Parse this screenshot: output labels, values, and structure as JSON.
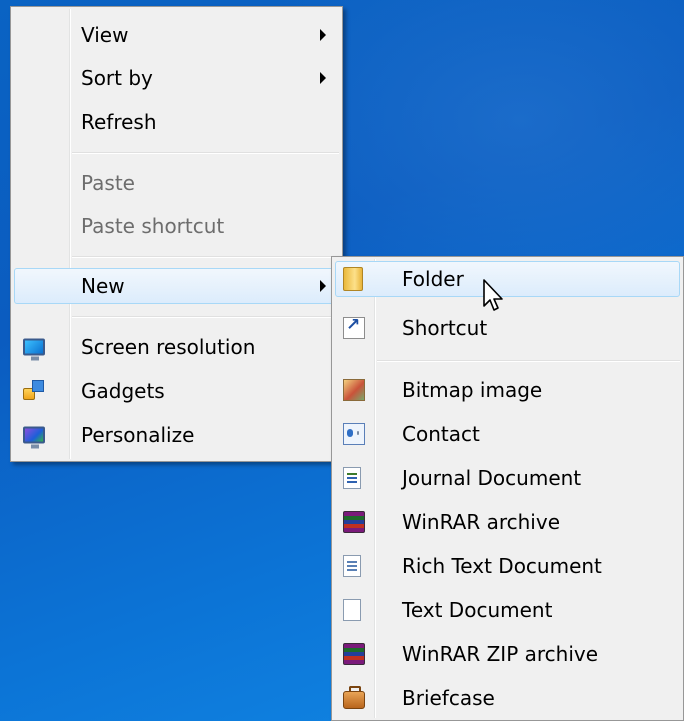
{
  "context_menu": {
    "items": [
      {
        "label": "View",
        "has_submenu": true
      },
      {
        "label": "Sort by",
        "has_submenu": true
      },
      {
        "label": "Refresh"
      },
      {
        "label": "Paste",
        "disabled": true
      },
      {
        "label": "Paste shortcut",
        "disabled": true
      },
      {
        "label": "New",
        "has_submenu": true,
        "highlighted": true
      },
      {
        "label": "Screen resolution",
        "icon": "screen-resolution-icon"
      },
      {
        "label": "Gadgets",
        "icon": "gadgets-icon"
      },
      {
        "label": "Personalize",
        "icon": "personalize-icon"
      }
    ]
  },
  "new_submenu": {
    "items": [
      {
        "label": "Folder",
        "icon": "folder-icon",
        "highlighted": true
      },
      {
        "label": "Shortcut",
        "icon": "shortcut-icon"
      },
      {
        "label": "Bitmap image",
        "icon": "bitmap-image-icon"
      },
      {
        "label": "Contact",
        "icon": "contact-icon"
      },
      {
        "label": "Journal Document",
        "icon": "journal-document-icon"
      },
      {
        "label": "WinRAR archive",
        "icon": "winrar-archive-icon"
      },
      {
        "label": "Rich Text Document",
        "icon": "rich-text-document-icon"
      },
      {
        "label": "Text Document",
        "icon": "text-document-icon"
      },
      {
        "label": "WinRAR ZIP archive",
        "icon": "winrar-zip-archive-icon"
      },
      {
        "label": "Briefcase",
        "icon": "briefcase-icon"
      }
    ]
  },
  "colors": {
    "desktop_background": "#0b5cc0",
    "menu_background": "#f0f0f0",
    "highlight_border": "#a8d8f7",
    "disabled_text": "#6d6d6d"
  }
}
